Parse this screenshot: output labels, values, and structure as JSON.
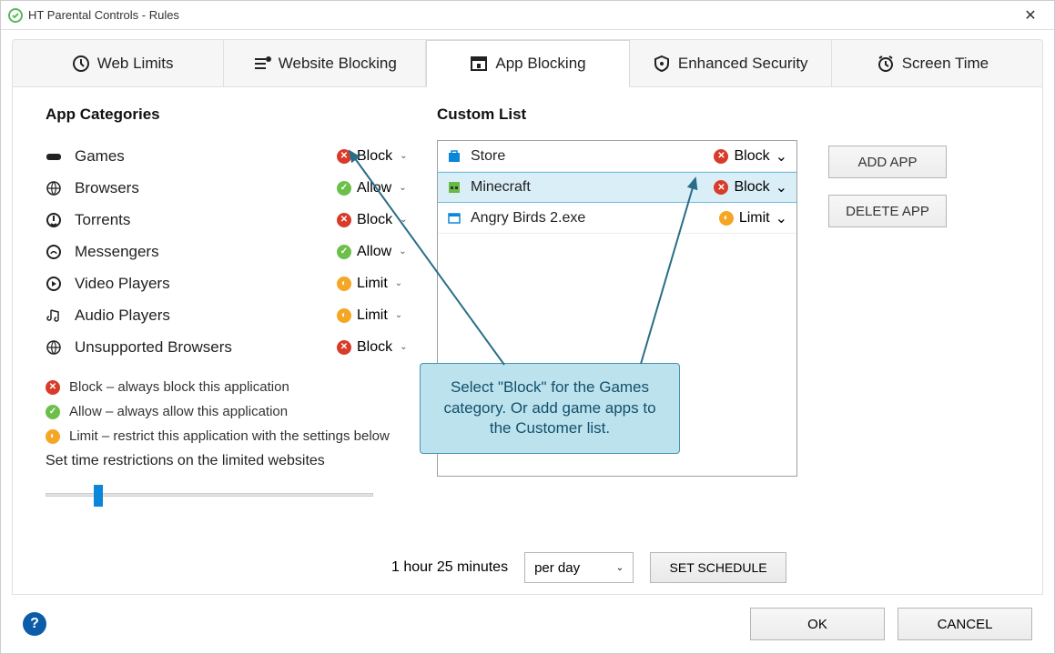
{
  "title": "HT Parental Controls - Rules",
  "tabs": [
    {
      "label": "Web Limits"
    },
    {
      "label": "Website Blocking"
    },
    {
      "label": "App Blocking",
      "active": true
    },
    {
      "label": "Enhanced Security"
    },
    {
      "label": "Screen Time"
    }
  ],
  "appCategoriesHeading": "App Categories",
  "categories": [
    {
      "name": "Games",
      "action": "Block",
      "mark": "block"
    },
    {
      "name": "Browsers",
      "action": "Allow",
      "mark": "allow"
    },
    {
      "name": "Torrents",
      "action": "Block",
      "mark": "block"
    },
    {
      "name": "Messengers",
      "action": "Allow",
      "mark": "allow"
    },
    {
      "name": "Video Players",
      "action": "Limit",
      "mark": "limit"
    },
    {
      "name": "Audio Players",
      "action": "Limit",
      "mark": "limit"
    },
    {
      "name": "Unsupported Browsers",
      "action": "Block",
      "mark": "block"
    }
  ],
  "legend": [
    {
      "mark": "block",
      "text": "Block – always block this application"
    },
    {
      "mark": "allow",
      "text": "Allow – always allow this application"
    },
    {
      "mark": "limit",
      "text": "Limit – restrict this application with the settings below"
    }
  ],
  "sliderLabel": "Set time restrictions on the limited websites",
  "customListHeading": "Custom List",
  "customList": [
    {
      "name": "Store",
      "action": "Block",
      "mark": "block",
      "selected": false
    },
    {
      "name": "Minecraft",
      "action": "Block",
      "mark": "block",
      "selected": true
    },
    {
      "name": "Angry Birds 2.exe",
      "action": "Limit",
      "mark": "limit",
      "selected": false
    }
  ],
  "addApp": "ADD APP",
  "deleteApp": "DELETE APP",
  "timeText": "1 hour 25 minutes",
  "perDay": "per day",
  "setSchedule": "SET SCHEDULE",
  "ok": "OK",
  "cancel": "CANCEL",
  "calloutText": "Select \"Block\" for the Games category. Or add game apps to the Customer list."
}
